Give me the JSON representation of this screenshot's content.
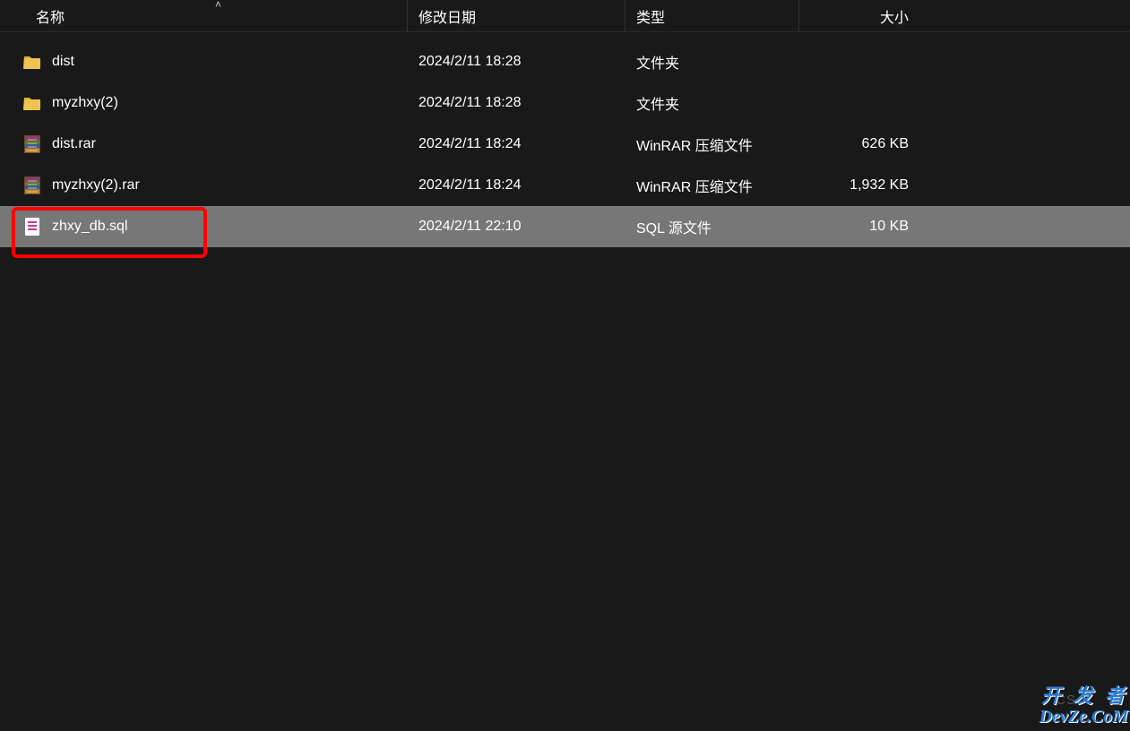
{
  "columns": {
    "name": "名称",
    "date": "修改日期",
    "type": "类型",
    "size": "大小"
  },
  "sort_indicator": "˄",
  "rows": [
    {
      "icon": "folder",
      "name": "dist",
      "date": "2024/2/11 18:28",
      "type": "文件夹",
      "size": "",
      "selected": false
    },
    {
      "icon": "folder",
      "name": "myzhxy(2)",
      "date": "2024/2/11 18:28",
      "type": "文件夹",
      "size": "",
      "selected": false
    },
    {
      "icon": "rar",
      "name": "dist.rar",
      "date": "2024/2/11 18:24",
      "type": "WinRAR 压缩文件",
      "size": "626 KB",
      "selected": false
    },
    {
      "icon": "rar",
      "name": "myzhxy(2).rar",
      "date": "2024/2/11 18:24",
      "type": "WinRAR 压缩文件",
      "size": "1,932 KB",
      "selected": false
    },
    {
      "icon": "sql",
      "name": "zhxy_db.sql",
      "date": "2024/2/11 22:10",
      "type": "SQL 源文件",
      "size": "10 KB",
      "selected": true
    }
  ],
  "watermark": {
    "faint": "CS",
    "line1": "开 发 者",
    "line2": "DevZe.CoM"
  }
}
